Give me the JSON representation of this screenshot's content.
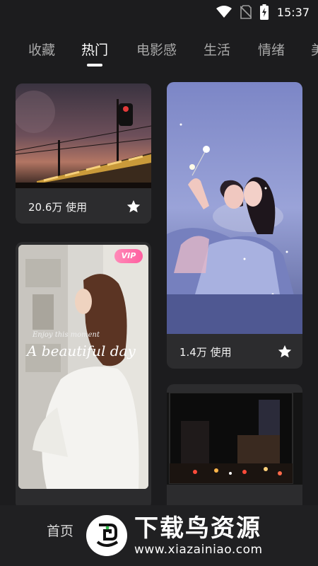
{
  "status_bar": {
    "time": "15:37",
    "icons": [
      "wifi-icon",
      "no-sim-icon",
      "battery-charging-icon"
    ]
  },
  "tabs": [
    {
      "label": "收藏",
      "active": false
    },
    {
      "label": "热门",
      "active": true
    },
    {
      "label": "电影感",
      "active": false
    },
    {
      "label": "生活",
      "active": false
    },
    {
      "label": "情绪",
      "active": false
    },
    {
      "label": "美",
      "active": false
    }
  ],
  "cards": [
    {
      "usage": "20.6万 使用",
      "icon": "star-icon"
    },
    {
      "usage": "1.4万 使用",
      "icon": "star-icon"
    },
    {
      "vip": "VIP",
      "overlay_small": "Enjoy this moment",
      "overlay_big": "A beautiful day"
    }
  ],
  "bottom_nav": {
    "home_label": "首页"
  },
  "watermark": {
    "title": "下载鸟资源",
    "url": "www.xiazainiao.com"
  },
  "colors": {
    "background": "#1c1c1e",
    "card": "#2c2c2e",
    "accent_vip": "#ff6fa8"
  }
}
